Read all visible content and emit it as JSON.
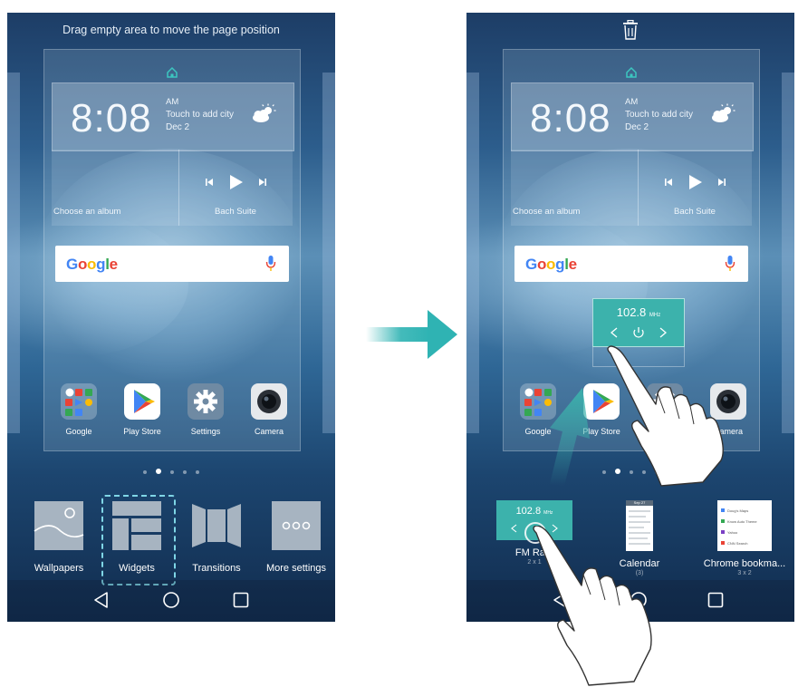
{
  "colors": {
    "accent_teal": "#3cb2ac",
    "arrow_teal": "#2fb3b3",
    "highlight_dash": "#7fd6e6"
  },
  "left_screen": {
    "hint_text": "Drag empty area to move the page position",
    "clock": {
      "time": "8:08",
      "ampm": "AM",
      "city_prompt": "Touch to add city",
      "date": "Dec 2"
    },
    "music": {
      "album_prompt": "Choose an album",
      "track": "Bach Suite"
    },
    "search": {
      "logo": "Google"
    },
    "apps": [
      {
        "label": "Google",
        "icon": "google-folder-icon"
      },
      {
        "label": "Play Store",
        "icon": "play-store-icon"
      },
      {
        "label": "Settings",
        "icon": "settings-gear-icon"
      },
      {
        "label": "Camera",
        "icon": "camera-icon"
      }
    ],
    "tray": [
      {
        "label": "Wallpapers",
        "icon": "wallpapers-icon"
      },
      {
        "label": "Widgets",
        "icon": "widgets-icon"
      },
      {
        "label": "Transitions",
        "icon": "transitions-icon"
      },
      {
        "label": "More settings",
        "icon": "more-settings-icon"
      }
    ]
  },
  "right_screen": {
    "clock": {
      "time": "8:08",
      "ampm": "AM",
      "city_prompt": "Touch to add city",
      "date": "Dec 2"
    },
    "music": {
      "album_prompt": "Choose an album",
      "track": "Bach Suite"
    },
    "search": {
      "logo": "Google"
    },
    "dragged_widget": {
      "frequency": "102.8",
      "unit": "MHz"
    },
    "apps": [
      {
        "label": "Google",
        "icon": "google-folder-icon"
      },
      {
        "label": "Play Store",
        "icon": "play-store-icon"
      },
      {
        "label": "Settings",
        "icon": "settings-gear-icon"
      },
      {
        "label": "Camera",
        "icon": "camera-icon"
      }
    ],
    "widget_list": [
      {
        "label": "FM Ra...",
        "size": "2 x 1",
        "icon": "fm-radio-widget-icon"
      },
      {
        "label": "Calendar",
        "size": "(3)",
        "icon": "calendar-widget-icon"
      },
      {
        "label": "Chrome bookma...",
        "size": "3 x 2",
        "icon": "chrome-bookmarks-widget-icon"
      }
    ],
    "fm_preview": {
      "frequency": "102.8",
      "unit": "MHz"
    },
    "calendar_preview": {
      "month": "Sep 27"
    },
    "chrome_preview": {
      "items": [
        "Doug's Maps",
        "Know Auto Theme",
        "Yahoo",
        "CNN Search"
      ]
    }
  }
}
